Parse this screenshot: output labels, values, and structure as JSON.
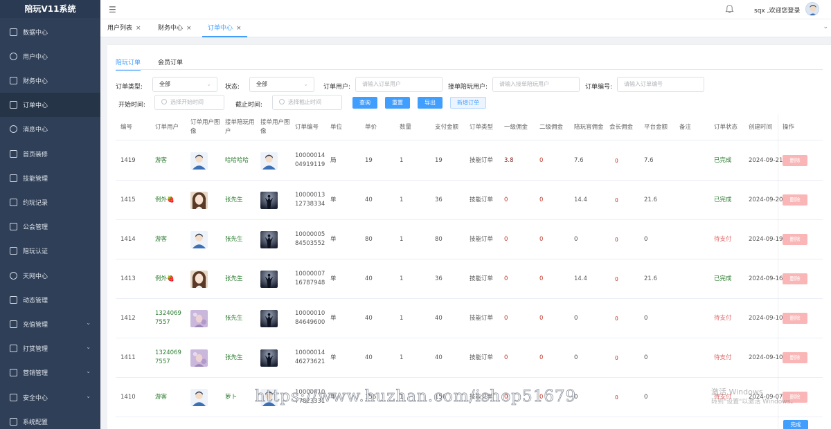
{
  "app": {
    "title": "陪玩V11系统"
  },
  "sidebar": {
    "items": [
      {
        "label": "数据中心",
        "icon": "chart-icon"
      },
      {
        "label": "用户中心",
        "icon": "user-icon"
      },
      {
        "label": "财务中心",
        "icon": "wallet-icon"
      },
      {
        "label": "订单中心",
        "icon": "order-icon"
      },
      {
        "label": "消息中心",
        "icon": "message-icon"
      },
      {
        "label": "首页装修",
        "icon": "home-icon"
      },
      {
        "label": "技能管理",
        "icon": "skill-icon"
      },
      {
        "label": "约玩记录",
        "icon": "layers-icon"
      },
      {
        "label": "公会管理",
        "icon": "guild-icon"
      },
      {
        "label": "陪玩认证",
        "icon": "certify-icon"
      },
      {
        "label": "天网中心",
        "icon": "globe-icon"
      },
      {
        "label": "动态管理",
        "icon": "dynamic-icon"
      },
      {
        "label": "充值管理",
        "icon": "recharge-icon"
      },
      {
        "label": "打赏管理",
        "icon": "reward-icon"
      },
      {
        "label": "营销管理",
        "icon": "marketing-icon"
      },
      {
        "label": "安全中心",
        "icon": "shield-icon"
      },
      {
        "label": "系统配置",
        "icon": "settings-icon"
      }
    ]
  },
  "header": {
    "welcome": "sqx ,欢迎您登录"
  },
  "tabs": [
    {
      "label": "用户列表",
      "close": "×"
    },
    {
      "label": "财务中心",
      "close": "×"
    },
    {
      "label": "订单中心",
      "close": "×"
    }
  ],
  "subtabs": [
    "陪玩订单",
    "会员订单"
  ],
  "filters": {
    "order_type_label": "订单类型:",
    "order_type_value": "全部",
    "status_label": "状态:",
    "status_value": "全部",
    "order_user_label": "订单用户:",
    "order_user_placeholder": "请输入订单用户",
    "companion_label": "接单陪玩用户:",
    "companion_placeholder": "请输入接单陪玩用户",
    "order_no_label": "订单编号:",
    "order_no_placeholder": "请输入订单编号",
    "start_label": "开始时间:",
    "start_placeholder": "选择开始时间",
    "end_label": "截止时间:",
    "end_placeholder": "选择截止时间"
  },
  "buttons": {
    "query": "查询",
    "reset": "重置",
    "export": "导出",
    "add": "新增订单"
  },
  "table": {
    "headers": [
      "编号",
      "订单用户",
      "订单用户图像",
      "接单陪玩用户",
      "接单用户图像",
      "订单编号",
      "单位",
      "单价",
      "数量",
      "支付金额",
      "订单类型",
      "一级佣金",
      "二级佣金",
      "陪玩官佣金",
      "会长佣金",
      "平台金额",
      "备注",
      "订单状态",
      "创建时间",
      "操作"
    ],
    "rows": [
      {
        "id": "1419",
        "user": "游客",
        "user_img": "cartoon-avatar",
        "companion": "哈哈哈哈",
        "companion_img": "cartoon-avatar",
        "order_no": "1000001404919119",
        "unit": "局",
        "price": "19",
        "qty": "1",
        "pay": "19",
        "type": "技能订单",
        "c1": "3.8",
        "c2": "0",
        "c3": "7.6",
        "c4": "0",
        "platform": "7.6",
        "remark": "",
        "status": "已完成",
        "created": "2024-09-21",
        "action": "删除"
      },
      {
        "id": "1415",
        "user": "例外🍓",
        "user_img": "girl-photo",
        "companion": "张先生",
        "companion_img": "dark-silhouette",
        "order_no": "1000001312738334",
        "unit": "单",
        "price": "40",
        "qty": "1",
        "pay": "36",
        "type": "技能订单",
        "c1": "0",
        "c2": "0",
        "c3": "14.4",
        "c4": "0",
        "platform": "21.6",
        "remark": "",
        "status": "已完成",
        "created": "2024-09-20",
        "action": "删除"
      },
      {
        "id": "1414",
        "user": "游客",
        "user_img": "cartoon-avatar",
        "companion": "张先生",
        "companion_img": "dark-silhouette",
        "order_no": "1000000584503552",
        "unit": "单",
        "price": "80",
        "qty": "1",
        "pay": "80",
        "type": "技能订单",
        "c1": "0",
        "c2": "0",
        "c3": "0",
        "c4": "0",
        "platform": "0",
        "remark": "",
        "status": "待支付",
        "created": "2024-09-19",
        "action": "删除"
      },
      {
        "id": "1413",
        "user": "例外🍓",
        "user_img": "girl-photo",
        "companion": "张先生",
        "companion_img": "dark-silhouette",
        "order_no": "1000000716787948",
        "unit": "单",
        "price": "40",
        "qty": "1",
        "pay": "36",
        "type": "技能订单",
        "c1": "0",
        "c2": "0",
        "c3": "14.4",
        "c4": "0",
        "platform": "21.6",
        "remark": "",
        "status": "已完成",
        "created": "2024-09-16",
        "action": "删除"
      },
      {
        "id": "1412",
        "user": "13240697557",
        "user_img": "purple-photo",
        "companion": "张先生",
        "companion_img": "dark-silhouette",
        "order_no": "1000001084649600",
        "unit": "单",
        "price": "40",
        "qty": "1",
        "pay": "40",
        "type": "技能订单",
        "c1": "0",
        "c2": "0",
        "c3": "0",
        "c4": "0",
        "platform": "0",
        "remark": "",
        "status": "待支付",
        "created": "2024-09-10",
        "action": "删除"
      },
      {
        "id": "1411",
        "user": "13240697557",
        "user_img": "purple-photo",
        "companion": "张先生",
        "companion_img": "dark-silhouette",
        "order_no": "1000001446273621",
        "unit": "单",
        "price": "40",
        "qty": "1",
        "pay": "40",
        "type": "技能订单",
        "c1": "0",
        "c2": "0",
        "c3": "0",
        "c4": "0",
        "platform": "0",
        "remark": "",
        "status": "待支付",
        "created": "2024-09-10",
        "action": "删除"
      },
      {
        "id": "1410",
        "user": "游客",
        "user_img": "cartoon-avatar",
        "companion": "萝卜",
        "companion_img": "cartoon-avatar",
        "order_no": "1000001077823331",
        "unit": "单",
        "price": "156",
        "qty": "1",
        "pay": "156",
        "type": "技能订单",
        "c1": "0",
        "c2": "0",
        "c3": "0",
        "c4": "0",
        "platform": "0",
        "remark": "",
        "status": "待支付",
        "created": "2024-09-07",
        "action": "删除"
      }
    ]
  },
  "done_button": "完成",
  "watermark": "https://www.huzhan.com/ishop51679",
  "windows_watermark": {
    "line1": "激活 Windows",
    "line2": "转到\"设置\"以激活 Windows。"
  }
}
